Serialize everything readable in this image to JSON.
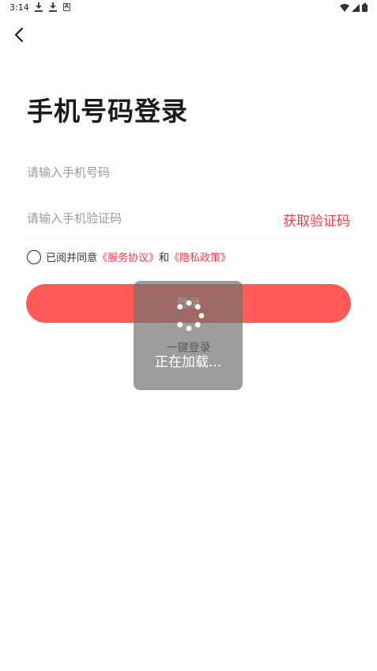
{
  "status_bar": {
    "time": "3:14",
    "left_icons": [
      "download-icon",
      "download-icon",
      "a-icon"
    ],
    "right_icons": [
      "wifi-icon",
      "signal-icon",
      "battery-icon"
    ]
  },
  "header": {
    "back_icon": "chevron-left-icon",
    "title": "手机号码登录"
  },
  "form": {
    "phone_placeholder": "请输入手机号码",
    "code_placeholder": "请输入手机验证码",
    "get_code_label": "获取验证码"
  },
  "agreement": {
    "prefix": "已阅并同意",
    "service_link": "《服务协议》",
    "conjunction": "和",
    "privacy_link": "《隐私政策》"
  },
  "login_button_label": "登录",
  "one_key_login_label": "一键登录",
  "loading": {
    "text": "正在加载..."
  },
  "colors": {
    "accent": "#ef3b4a",
    "button": "#ff5a55",
    "overlay": "#6e6e6e"
  }
}
